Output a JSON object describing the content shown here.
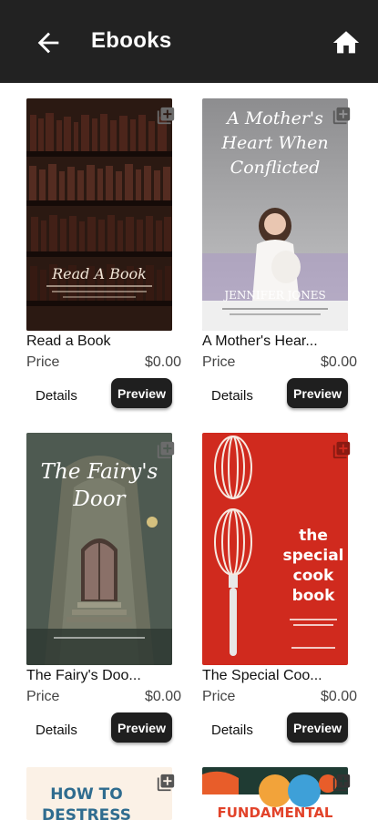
{
  "app_bar": {
    "title": "Ebooks",
    "back_icon": "arrow-left-icon",
    "home_icon": "home-icon",
    "background": "#222222"
  },
  "books": [
    {
      "title": "Read a Book",
      "price_label": "Price",
      "price": "$0.00",
      "details_label": "Details",
      "preview_label": "Preview",
      "cover_text": [
        "Read A Book"
      ]
    },
    {
      "title": "A Mother's Hear...",
      "price_label": "Price",
      "price": "$0.00",
      "details_label": "Details",
      "preview_label": "Preview",
      "cover_text": [
        "A Mother's",
        "Heart When",
        "Conflicted",
        "JENNIFER JONES"
      ]
    },
    {
      "title": "The Fairy's Doo...",
      "price_label": "Price",
      "price": "$0.00",
      "details_label": "Details",
      "preview_label": "Preview",
      "cover_text": [
        "The Fairy's",
        "Door"
      ]
    },
    {
      "title": "The Special Coo...",
      "price_label": "Price",
      "price": "$0.00",
      "details_label": "Details",
      "preview_label": "Preview",
      "cover_text": [
        "the",
        "special",
        "cook",
        "book"
      ]
    }
  ],
  "partial_books": [
    {
      "cover_text": [
        "HOW TO",
        "DESTRESS"
      ]
    },
    {
      "cover_text": [
        "FUNDAMENTAL"
      ]
    }
  ],
  "icons": {
    "add_to_list": "add-to-list-icon"
  },
  "colors": {
    "preview_button": "#1f1f1f",
    "cookbook_red": "#d02a1e"
  }
}
